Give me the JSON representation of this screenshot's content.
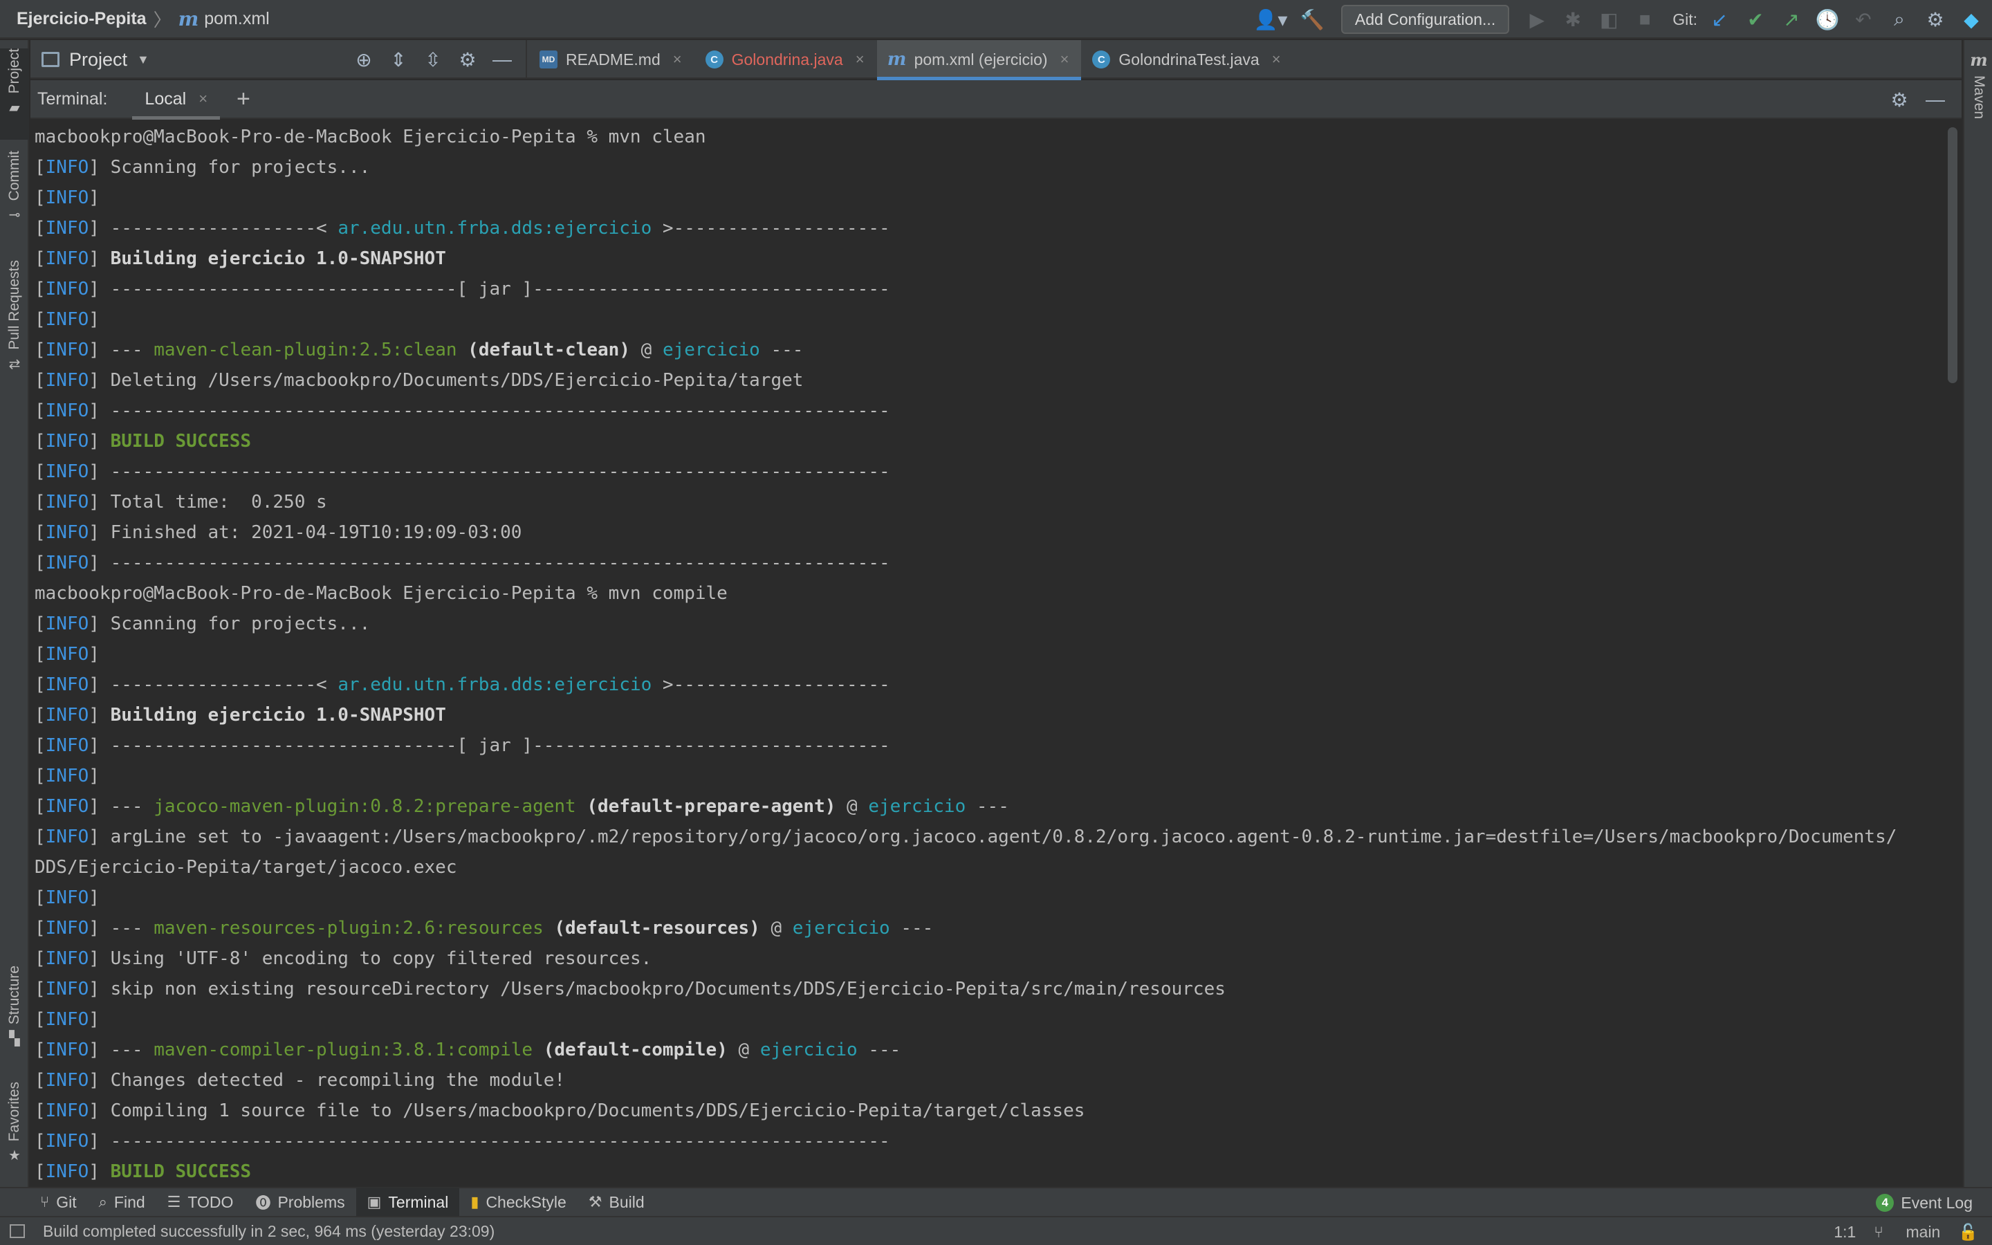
{
  "breadcrumb": {
    "project": "Ejercicio-Pepita",
    "file": "pom.xml"
  },
  "navbar": {
    "run_config": "Add Configuration...",
    "git_label": "Git:"
  },
  "project_panel": {
    "title": "Project"
  },
  "editor_tabs": [
    {
      "label": "README.md",
      "icon": "markdown-file-icon",
      "active": false
    },
    {
      "label": "Golondrina.java",
      "icon": "java-class-icon",
      "active": false,
      "error": true
    },
    {
      "label": "pom.xml (ejercicio)",
      "icon": "maven-file-icon",
      "active": true
    },
    {
      "label": "GolondrinaTest.java",
      "icon": "java-test-class-icon",
      "active": false
    }
  ],
  "left_stripe": {
    "project": "Project",
    "commit": "Commit",
    "pull_requests": "Pull Requests",
    "structure": "Structure",
    "favorites": "Favorites"
  },
  "right_stripe": {
    "maven": "Maven"
  },
  "terminal": {
    "title": "Terminal:",
    "tab": "Local",
    "lines": [
      {
        "prompt": "macbookpro@MacBook-Pro-de-MacBook Ejercicio-Pepita % mvn clean"
      },
      {
        "text": " Scanning for projects..."
      },
      {
        "text": ""
      },
      {
        "pre": " -------------------< ",
        "cyan": "ar.edu.utn.frba.dds:ejercicio",
        "post": " >--------------------"
      },
      {
        "bold": " Building ejercicio 1.0-SNAPSHOT"
      },
      {
        "text": " --------------------------------[ jar ]---------------------------------"
      },
      {
        "text": ""
      },
      {
        "pre": " --- ",
        "green": "maven-clean-plugin:2.5:clean",
        "boldmid": " (default-clean)",
        "at": " @ ",
        "cyan2": "ejercicio",
        "post": " ---"
      },
      {
        "text": " Deleting /Users/macbookpro/Documents/DDS/Ejercicio-Pepita/target"
      },
      {
        "text": " ------------------------------------------------------------------------"
      },
      {
        "success": " BUILD SUCCESS"
      },
      {
        "text": " ------------------------------------------------------------------------"
      },
      {
        "text": " Total time:  0.250 s"
      },
      {
        "text": " Finished at: 2021-04-19T10:19:09-03:00"
      },
      {
        "text": " ------------------------------------------------------------------------"
      },
      {
        "prompt": "macbookpro@MacBook-Pro-de-MacBook Ejercicio-Pepita % mvn compile"
      },
      {
        "text": " Scanning for projects..."
      },
      {
        "text": ""
      },
      {
        "pre": " -------------------< ",
        "cyan": "ar.edu.utn.frba.dds:ejercicio",
        "post": " >--------------------"
      },
      {
        "bold": " Building ejercicio 1.0-SNAPSHOT"
      },
      {
        "text": " --------------------------------[ jar ]---------------------------------"
      },
      {
        "text": ""
      },
      {
        "pre": " --- ",
        "green": "jacoco-maven-plugin:0.8.2:prepare-agent",
        "boldmid": " (default-prepare-agent)",
        "at": " @ ",
        "cyan2": "ejercicio",
        "post": " ---"
      },
      {
        "text": " argLine set to -javaagent:/Users/macbookpro/.m2/repository/org/jacoco/org.jacoco.agent/0.8.2/org.jacoco.agent-0.8.2-runtime.jar=destfile=/Users/macbookpro/Documents/"
      },
      {
        "cont": "DDS/Ejercicio-Pepita/target/jacoco.exec"
      },
      {
        "text": ""
      },
      {
        "pre": " --- ",
        "green": "maven-resources-plugin:2.6:resources",
        "boldmid": " (default-resources)",
        "at": " @ ",
        "cyan2": "ejercicio",
        "post": " ---"
      },
      {
        "text": " Using 'UTF-8' encoding to copy filtered resources."
      },
      {
        "text": " skip non existing resourceDirectory /Users/macbookpro/Documents/DDS/Ejercicio-Pepita/src/main/resources"
      },
      {
        "text": ""
      },
      {
        "pre": " --- ",
        "green": "maven-compiler-plugin:3.8.1:compile",
        "boldmid": " (default-compile)",
        "at": " @ ",
        "cyan2": "ejercicio",
        "post": " ---"
      },
      {
        "text": " Changes detected - recompiling the module!"
      },
      {
        "text": " Compiling 1 source file to /Users/macbookpro/Documents/DDS/Ejercicio-Pepita/target/classes"
      },
      {
        "text": " ------------------------------------------------------------------------"
      },
      {
        "success": " BUILD SUCCESS"
      }
    ]
  },
  "bottom_tools": [
    {
      "label": "Git",
      "icon": "git-branch-icon"
    },
    {
      "label": "Find",
      "icon": "search-icon"
    },
    {
      "label": "TODO",
      "icon": "list-icon"
    },
    {
      "label": "Problems",
      "icon": "warning-icon"
    },
    {
      "label": "Terminal",
      "icon": "terminal-icon",
      "active": true
    },
    {
      "label": "CheckStyle",
      "icon": "checkstyle-icon"
    },
    {
      "label": "Build",
      "icon": "hammer-icon"
    }
  ],
  "event_log": {
    "count": "4",
    "label": "Event Log"
  },
  "status": {
    "message": "Build completed successfully in 2 sec, 964 ms (yesterday 23:09)",
    "position": "1:1",
    "branch": "main"
  },
  "colors": {
    "background": "#2b2b2b",
    "panel": "#3c3f41",
    "info": "#3e93e0",
    "cyan": "#2aa1b3",
    "green": "#6a9a35",
    "accent": "#4a88c7"
  }
}
